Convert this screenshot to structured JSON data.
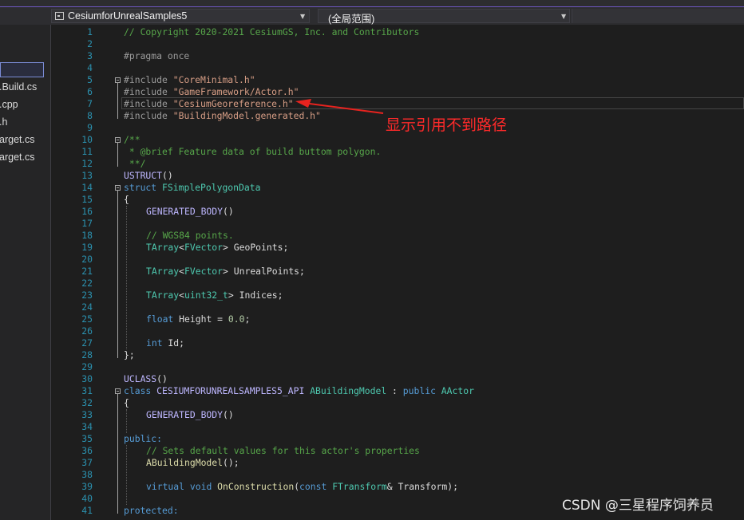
{
  "toolbar": {
    "project_selector": "CesiumforUnrealSamples5",
    "scope_selector": "(全局范围)"
  },
  "solution_explorer": {
    "files": [
      ".Build.cs",
      ".cpp",
      ".h",
      "arget.cs",
      "arget.cs"
    ]
  },
  "editor": {
    "line_numbers": [
      "1",
      "2",
      "3",
      "4",
      "5",
      "6",
      "7",
      "8",
      "9",
      "10",
      "11",
      "12",
      "13",
      "14",
      "15",
      "16",
      "17",
      "18",
      "19",
      "20",
      "21",
      "22",
      "23",
      "24",
      "25",
      "26",
      "27",
      "28",
      "29",
      "30",
      "31",
      "32",
      "33",
      "34",
      "35",
      "36",
      "37",
      "38",
      "39",
      "40",
      "41"
    ],
    "code": {
      "l1": "// Copyright 2020-2021 CesiumGS, Inc. and Contributors",
      "l3": "#pragma once",
      "inc_kw": "#include ",
      "l5_str": "\"CoreMinimal.h\"",
      "l6_str": "\"GameFramework/Actor.h\"",
      "l7_str": "\"CesiumGeoreference.h\"",
      "l8_str": "\"BuildingModel.generated.h\"",
      "l10": "/**",
      "l11": " * @brief Feature data of build buttom polygon.",
      "l12": " **/",
      "l13_macro": "USTRUCT",
      "parens": "()",
      "l14_kw": "struct ",
      "l14_type": "FSimplePolygonData",
      "l15": "{",
      "l16_macro": "GENERATED_BODY",
      "l18": "// WGS84 points.",
      "tarray": "TArray",
      "lt": "<",
      "fvector": "FVector",
      "gt": "> ",
      "l19_var": "GeoPoints;",
      "l21_var": "UnrealPoints;",
      "uint32": "uint32_t",
      "l23_var": "Indices;",
      "l25_kw": "float",
      "l25_var": " Height = ",
      "l25_num": "0.0",
      "semi": ";",
      "l27_kw": "int",
      "l27_var": " Id;",
      "l28": "};",
      "l30_macro": "UCLASS",
      "l31_kw": "class ",
      "l31_macro": "CESIUMFORUNREALSAMPLES5_API ",
      "l31_type": "ABuildingModel",
      "l31_sep": " : ",
      "l31_kw2": "public ",
      "l31_base": "AActor",
      "l32": "{",
      "l35": "public:",
      "l36": "// Sets default values for this actor's properties",
      "l37": "ABuildingModel",
      "l37_end": "();",
      "l39_kw1": "virtual ",
      "l39_kw2": "void ",
      "l39_func": "OnConstruction",
      "l39_p1": "(",
      "l39_kw3": "const ",
      "l39_type": "FTransform",
      "l39_rest": "& Transform);",
      "l41": "protected:"
    }
  },
  "annotation": {
    "note": "显示引用不到路径"
  },
  "watermark": "CSDN @三星程序饲养员",
  "colors": {
    "arrow": "#e8231f",
    "note": "#ff2a2a",
    "accent": "#6f58c4"
  }
}
